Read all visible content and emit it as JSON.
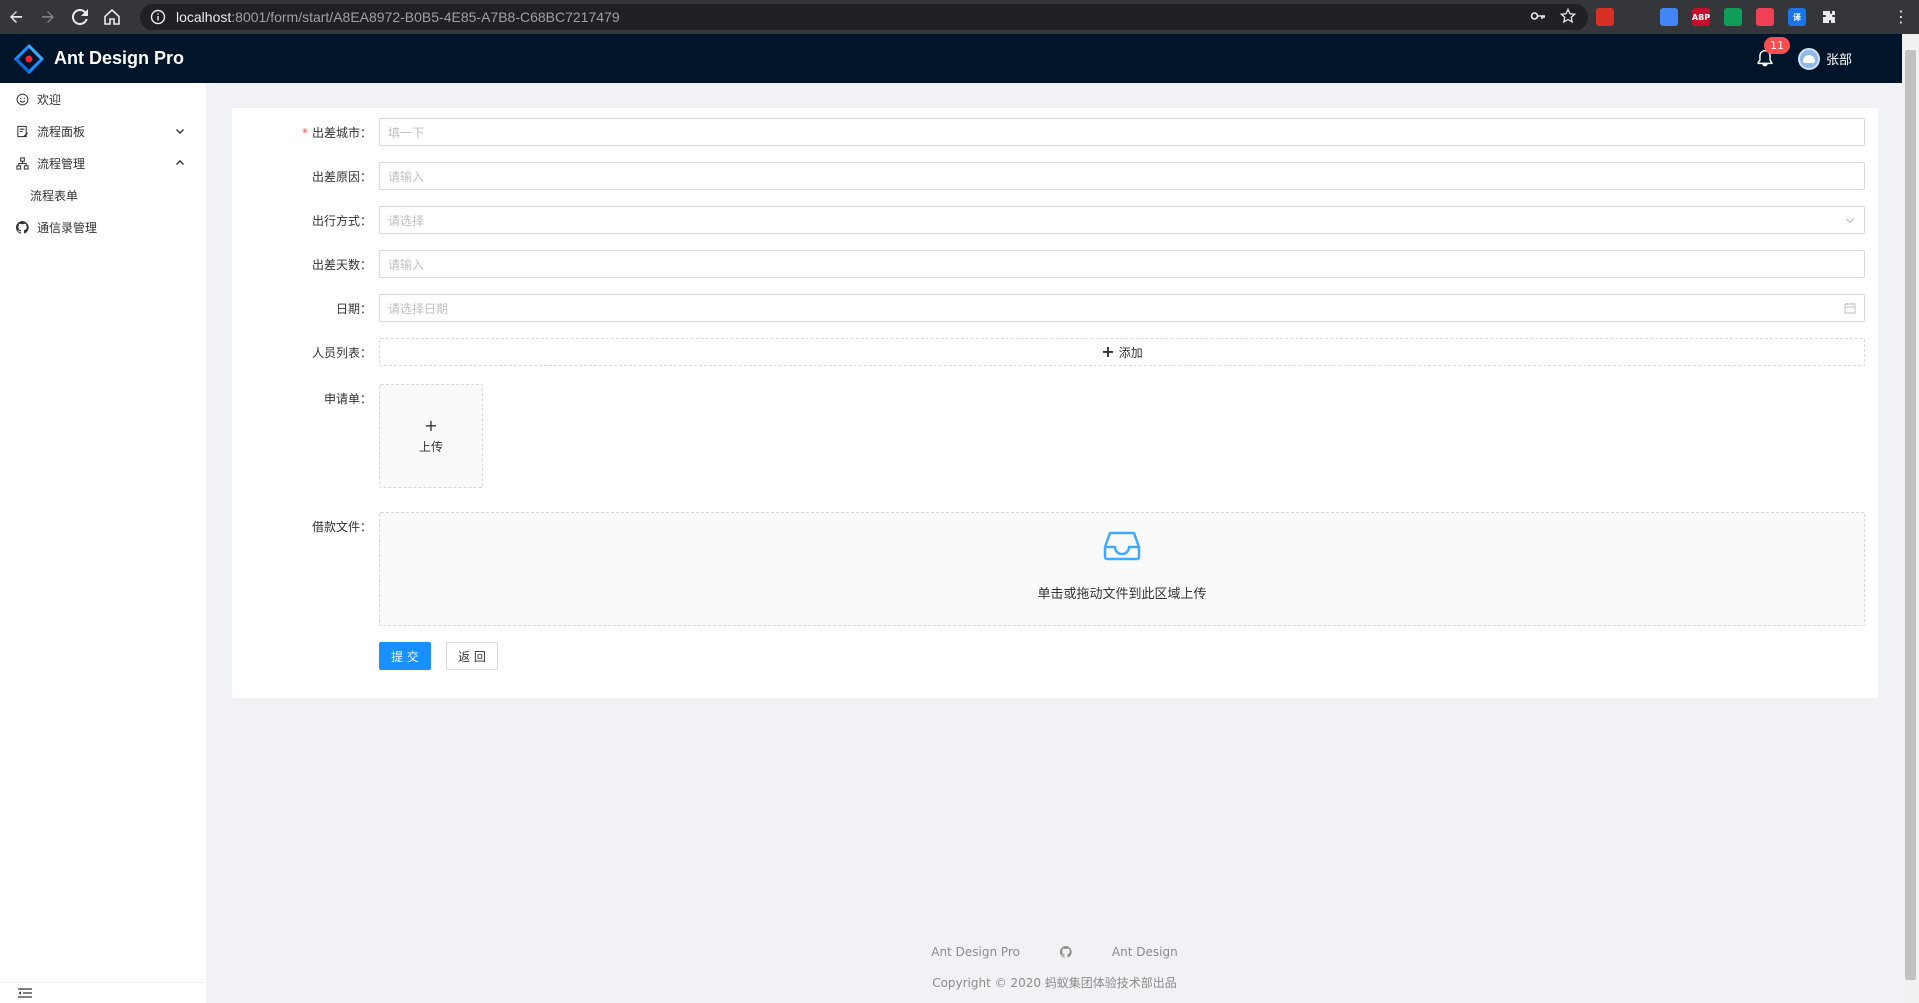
{
  "browser": {
    "url_host": "localhost",
    "url_path": ":8001/form/start/A8EA8972-B0B5-4E85-A7B8-C68BC7217479",
    "extensions": [
      {
        "name": "red-ext-icon",
        "color": "#d93025",
        "label": ""
      },
      {
        "name": "vue-ext-icon",
        "color": "#35363a",
        "label": ""
      },
      {
        "name": "translate-ext-icon",
        "color": "#4285f4",
        "label": ""
      },
      {
        "name": "abp-ext-icon",
        "color": "#c70d2c",
        "label": "ABP"
      },
      {
        "name": "shield-ext-icon",
        "color": "#0f9d58",
        "label": ""
      },
      {
        "name": "pocket-ext-icon",
        "color": "#ef4056",
        "label": ""
      },
      {
        "name": "translate2-ext-icon",
        "color": "#1a73e8",
        "label": "译"
      }
    ]
  },
  "header": {
    "title": "Ant Design Pro",
    "notification_count": "11",
    "user_name": "张部"
  },
  "sidebar": {
    "items": [
      {
        "label": "欢迎",
        "icon": "smile-icon"
      },
      {
        "label": "流程面板",
        "icon": "form-icon",
        "arrow": "down"
      },
      {
        "label": "流程管理",
        "icon": "cluster-icon",
        "arrow": "up"
      },
      {
        "label": "通信录管理",
        "icon": "github-icon"
      }
    ],
    "submenu": [
      {
        "label": "流程表单"
      }
    ]
  },
  "form": {
    "city": {
      "label": "出差城市",
      "required": "*",
      "placeholder": "填一下"
    },
    "reason": {
      "label": "出差原因",
      "placeholder": "请输入"
    },
    "travel_mode": {
      "label": "出行方式",
      "placeholder": "请选择"
    },
    "days": {
      "label": "出差天数",
      "placeholder": "请输入"
    },
    "date": {
      "label": "日期",
      "placeholder": "请选择日期"
    },
    "people": {
      "label": "人员列表",
      "add_label": "添加"
    },
    "application": {
      "label": "申请单",
      "upload_label": "上传"
    },
    "loan_files": {
      "label": "借款文件",
      "drag_text": "单击或拖动文件到此区域上传"
    },
    "submit_label": "提 交",
    "back_label": "返 回",
    "colon": "："
  },
  "footer": {
    "link1": "Ant Design Pro",
    "link2": "Ant Design",
    "copyright": "Copyright © 2020 蚂蚁集团体验技术部出品"
  },
  "colors": {
    "primary": "#1890ff",
    "header_bg": "#001529",
    "page_bg": "#f0f2f5"
  }
}
